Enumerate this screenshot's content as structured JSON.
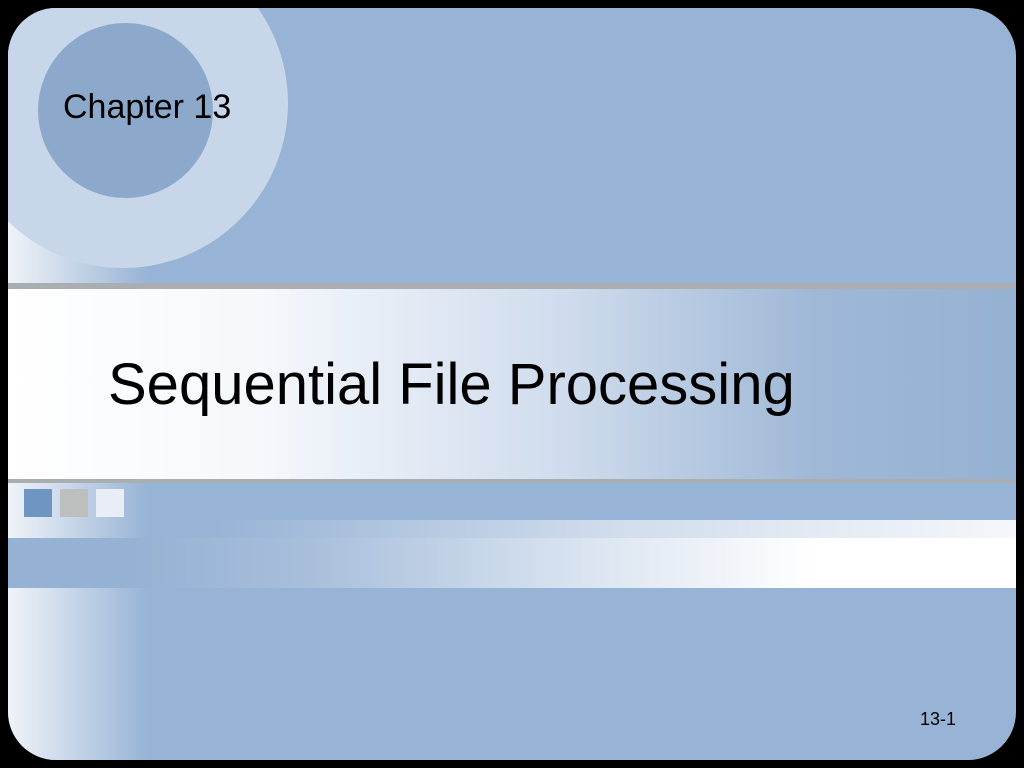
{
  "chapter_label": "Chapter 13",
  "title": "Sequential File Processing",
  "page_number": "13-1"
}
